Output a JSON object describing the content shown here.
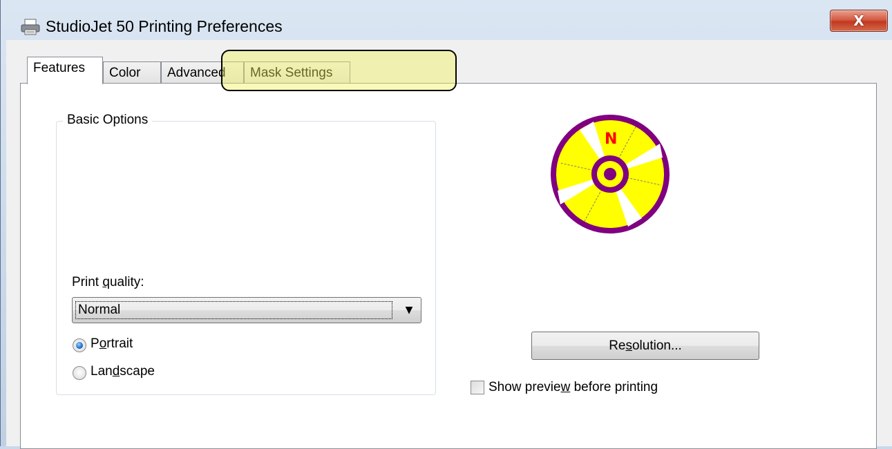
{
  "window": {
    "title": "StudioJet 50 Printing Preferences",
    "title_icon": "printer-icon",
    "close_icon": "close-icon",
    "close_glyph": "X"
  },
  "tabs": [
    {
      "label": "Features",
      "active": true
    },
    {
      "label": "Color",
      "active": false
    },
    {
      "label": "Advanced",
      "active": false
    },
    {
      "label": "Mask Settings",
      "active": false
    }
  ],
  "basic_options": {
    "group_title": "Basic Options",
    "print_quality": {
      "label_pre": "Print ",
      "label_ul": "q",
      "label_post": "uality:",
      "selected": "Normal",
      "arrow_icon": "dropdown-arrow-icon"
    },
    "orientation": {
      "portrait": {
        "pre": "P",
        "ul": "o",
        "post": "rtrait",
        "checked": true
      },
      "landscape": {
        "pre": "Lan",
        "ul": "d",
        "post": "scape",
        "checked": false
      }
    }
  },
  "preview": {
    "icon": "disc-preview-icon",
    "marker": "N",
    "colors": {
      "ring": "#800080",
      "fill": "#ffff00",
      "marker": "#ff0000"
    }
  },
  "resolution_button": {
    "pre": "Re",
    "ul": "s",
    "post": "olution..."
  },
  "show_preview": {
    "pre": "Show previe",
    "ul": "w",
    "post": " before printing",
    "checked": false
  },
  "highlight": {
    "target": "Mask Settings",
    "color": "#f0f05a"
  }
}
